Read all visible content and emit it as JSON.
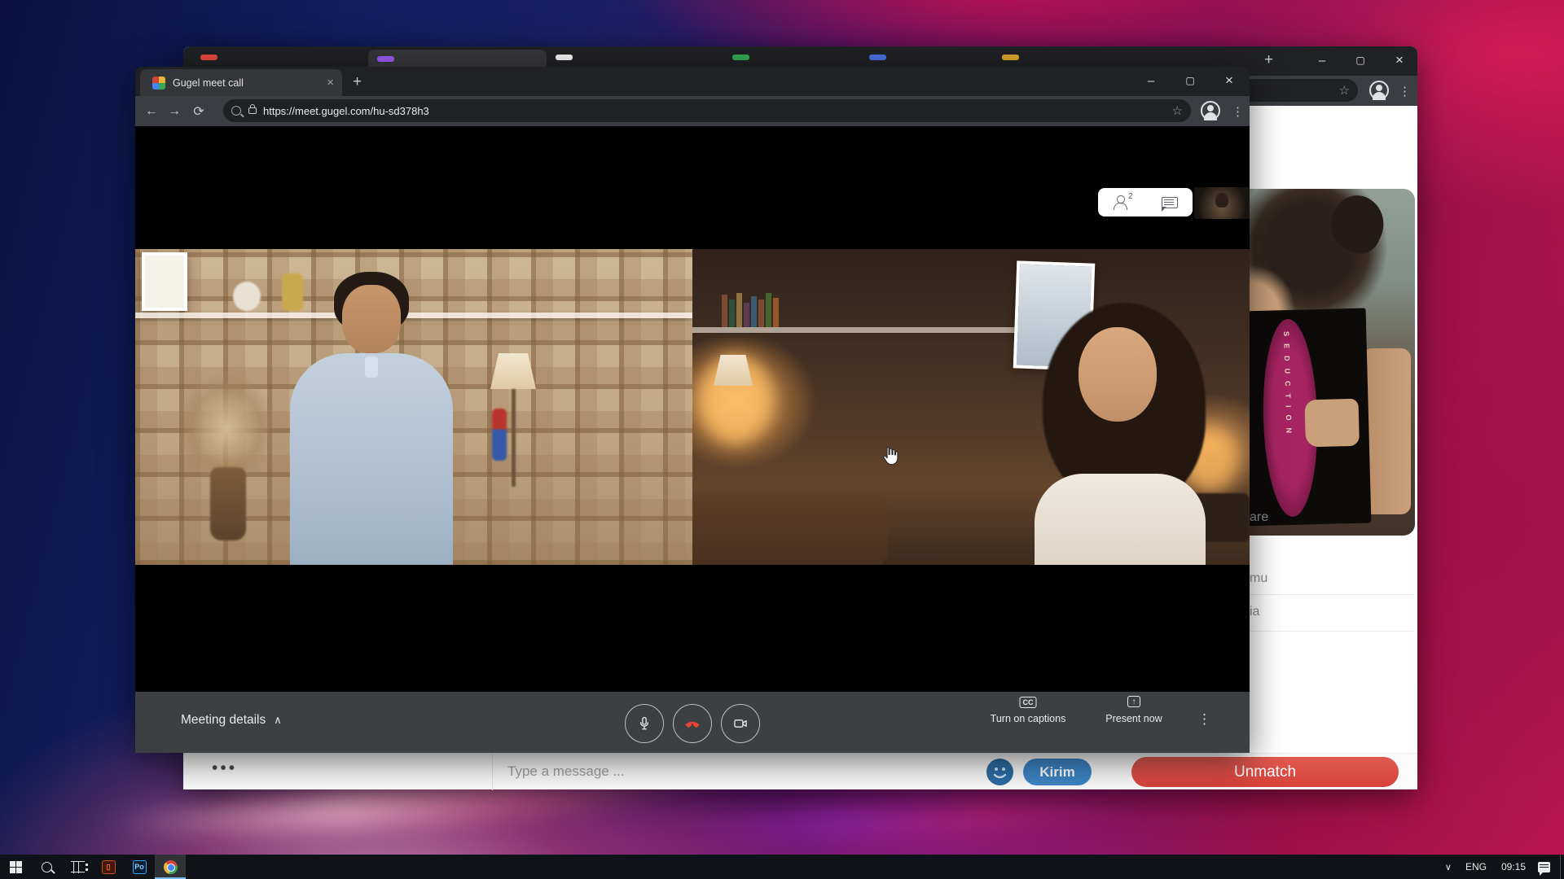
{
  "glyphs": {
    "close": "×",
    "minimize": "–",
    "maximize": "▢",
    "plus": "+",
    "back": "←",
    "forward": "→",
    "refresh": "⟳",
    "star": "☆",
    "kebab": "⋮",
    "chevron_up": "∧",
    "chevron_down": "∨",
    "present_arrow": "↑"
  },
  "meet_window": {
    "tab_title": "Gugel meet call",
    "url": "https://meet.gugel.com/hu-sd378h3",
    "participants_count": "2",
    "meeting_details_label": "Meeting details",
    "captions_icon_text": "CC",
    "captions_label": "Turn on captions",
    "present_label": "Present now"
  },
  "background_window": {
    "video_card": {
      "book_title": "SEDUCTION"
    },
    "list_fragments": {
      "row1": "are",
      "row2": "mu",
      "row3": "ia"
    },
    "chat_bar": {
      "typing_indicator": "•••",
      "message_placeholder": "Type a message ...",
      "send_label": "Kirim",
      "unmatch_label": "Unmatch"
    }
  },
  "taskbar": {
    "language": "ENG",
    "time": "09:15",
    "app_po_label": "Po"
  },
  "colors": {
    "send_blue": "#3d85c6",
    "unmatch_red": "#d8423b",
    "hangup_red": "#ea4335",
    "chrome_dark": "#202124",
    "toolbar_gray": "#3a3d42",
    "meet_bar_gray": "#3c4043",
    "wallpaper_blue": "#101e5e",
    "wallpaper_magenta": "#a01148"
  }
}
